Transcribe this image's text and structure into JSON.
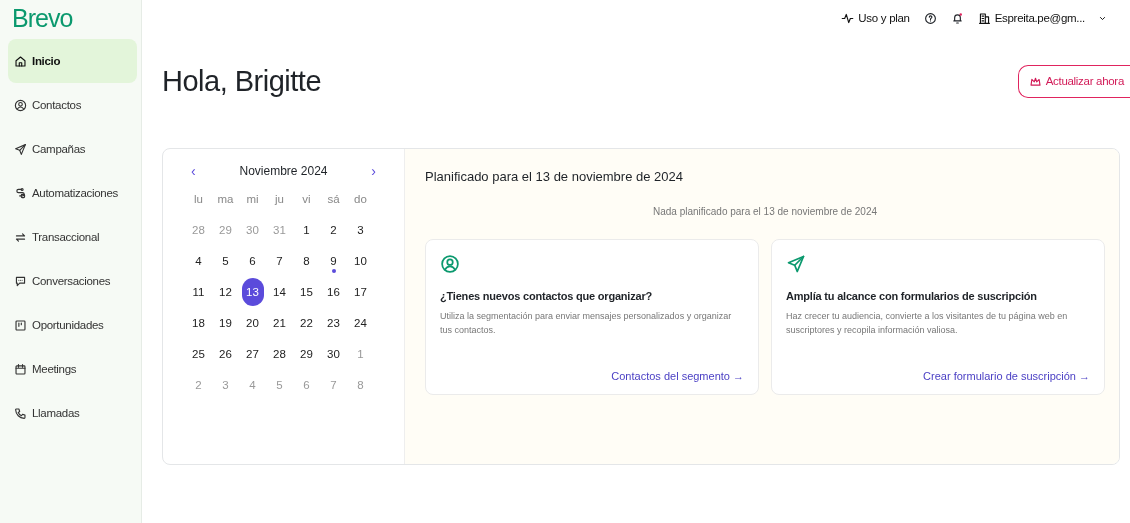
{
  "sidebar": {
    "logo": "Brevo",
    "items": [
      {
        "label": "Inicio",
        "selected": true
      },
      {
        "label": "Contactos",
        "selected": false
      },
      {
        "label": "Campañas",
        "selected": false
      },
      {
        "label": "Automatizaciones",
        "selected": false
      },
      {
        "label": "Transaccional",
        "selected": false
      },
      {
        "label": "Conversaciones",
        "selected": false
      },
      {
        "label": "Oportunidades",
        "selected": false
      },
      {
        "label": "Meetings",
        "selected": false
      },
      {
        "label": "Llamadas",
        "selected": false
      }
    ]
  },
  "topbar": {
    "usage": "Uso y plan",
    "account": "Espreita.pe@gm..."
  },
  "greeting": "Hola, Brigitte",
  "upgrade_button": "Actualizar ahora",
  "calendar": {
    "prev": "‹",
    "month": "Noviembre 2024",
    "next": "›",
    "weekdays": [
      "lu",
      "ma",
      "mi",
      "ju",
      "vi",
      "sá",
      "do"
    ],
    "days": [
      {
        "label": "28",
        "muted": true,
        "selected": false,
        "event": false
      },
      {
        "label": "29",
        "muted": true,
        "selected": false,
        "event": false
      },
      {
        "label": "30",
        "muted": true,
        "selected": false,
        "event": false
      },
      {
        "label": "31",
        "muted": true,
        "selected": false,
        "event": false
      },
      {
        "label": "1",
        "muted": false,
        "selected": false,
        "event": false
      },
      {
        "label": "2",
        "muted": false,
        "selected": false,
        "event": false
      },
      {
        "label": "3",
        "muted": false,
        "selected": false,
        "event": false
      },
      {
        "label": "4",
        "muted": false,
        "selected": false,
        "event": false
      },
      {
        "label": "5",
        "muted": false,
        "selected": false,
        "event": false
      },
      {
        "label": "6",
        "muted": false,
        "selected": false,
        "event": false
      },
      {
        "label": "7",
        "muted": false,
        "selected": false,
        "event": false
      },
      {
        "label": "8",
        "muted": false,
        "selected": false,
        "event": false
      },
      {
        "label": "9",
        "muted": false,
        "selected": false,
        "event": true
      },
      {
        "label": "10",
        "muted": false,
        "selected": false,
        "event": false
      },
      {
        "label": "11",
        "muted": false,
        "selected": false,
        "event": false
      },
      {
        "label": "12",
        "muted": false,
        "selected": false,
        "event": false
      },
      {
        "label": "13",
        "muted": false,
        "selected": true,
        "event": false
      },
      {
        "label": "14",
        "muted": false,
        "selected": false,
        "event": false
      },
      {
        "label": "15",
        "muted": false,
        "selected": false,
        "event": false
      },
      {
        "label": "16",
        "muted": false,
        "selected": false,
        "event": false
      },
      {
        "label": "17",
        "muted": false,
        "selected": false,
        "event": false
      },
      {
        "label": "18",
        "muted": false,
        "selected": false,
        "event": false
      },
      {
        "label": "19",
        "muted": false,
        "selected": false,
        "event": false
      },
      {
        "label": "20",
        "muted": false,
        "selected": false,
        "event": false
      },
      {
        "label": "21",
        "muted": false,
        "selected": false,
        "event": false
      },
      {
        "label": "22",
        "muted": false,
        "selected": false,
        "event": false
      },
      {
        "label": "23",
        "muted": false,
        "selected": false,
        "event": false
      },
      {
        "label": "24",
        "muted": false,
        "selected": false,
        "event": false
      },
      {
        "label": "25",
        "muted": false,
        "selected": false,
        "event": false
      },
      {
        "label": "26",
        "muted": false,
        "selected": false,
        "event": false
      },
      {
        "label": "27",
        "muted": false,
        "selected": false,
        "event": false
      },
      {
        "label": "28",
        "muted": false,
        "selected": false,
        "event": false
      },
      {
        "label": "29",
        "muted": false,
        "selected": false,
        "event": false
      },
      {
        "label": "30",
        "muted": false,
        "selected": false,
        "event": false
      },
      {
        "label": "1",
        "muted": true,
        "selected": false,
        "event": false
      },
      {
        "label": "2",
        "muted": true,
        "selected": false,
        "event": false
      },
      {
        "label": "3",
        "muted": true,
        "selected": false,
        "event": false
      },
      {
        "label": "4",
        "muted": true,
        "selected": false,
        "event": false
      },
      {
        "label": "5",
        "muted": true,
        "selected": false,
        "event": false
      },
      {
        "label": "6",
        "muted": true,
        "selected": false,
        "event": false
      },
      {
        "label": "7",
        "muted": true,
        "selected": false,
        "event": false
      },
      {
        "label": "8",
        "muted": true,
        "selected": false,
        "event": false
      }
    ]
  },
  "planning": {
    "title": "Planificado para el 13 de noviembre de 2024",
    "empty": "Nada planificado para el 13 de noviembre de 2024",
    "cards": [
      {
        "title": "¿Tienes nuevos contactos que organizar?",
        "text": "Utiliza la segmentación para enviar mensajes personalizados y organizar tus contactos.",
        "link": "Contactos del segmento →"
      },
      {
        "title": "Amplía tu alcance con formularios de suscripción",
        "text": "Haz crecer tu audiencia, convierte a los visitantes de tu página web en suscriptores y recopila información valiosa.",
        "link": "Crear formulario de suscripción →"
      }
    ]
  }
}
